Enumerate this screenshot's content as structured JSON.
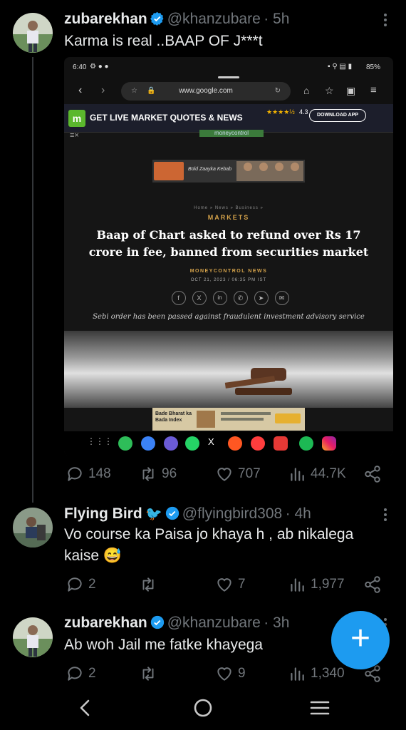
{
  "tweets": [
    {
      "name": "zubarekhan",
      "handle": "@khanzubare",
      "time": "· 5h",
      "text": "Karma is real ..BAAP OF J***t",
      "replies": "148",
      "retweets": "96",
      "likes": "707",
      "views": "44.7K"
    },
    {
      "name": "Flying Bird",
      "handle": "@flyingbird308",
      "time": "· 4h",
      "text": "Vo course ka Paisa jo khaya h , ab nikalega kaise 😅",
      "replies": "2",
      "retweets": "",
      "likes": "7",
      "views": "1,977"
    },
    {
      "name": "zubarekhan",
      "handle": "@khanzubare",
      "time": "· 3h",
      "text": "Ab woh Jail me fatke khayega",
      "replies": "2",
      "retweets": "",
      "likes": "9",
      "views": "1,340"
    }
  ],
  "embedded_screenshot": {
    "status_time": "6:40",
    "battery": "85%",
    "url": "www.google.com",
    "banner_title": "GET LIVE MARKET QUOTES & NEWS",
    "banner_rating": "4.3",
    "banner_button": "DOWNLOAD APP",
    "site_name": "moneycontrol",
    "ad_text": "Bold Zaayka Kebab",
    "breadcrumb": "Home » News » Business »",
    "section": "MARKETS",
    "headline": "Baap of Chart asked to refund over Rs 17 crore in fee, banned from securities market",
    "byline": "MONEYCONTROL NEWS",
    "dateline": "OCT 21, 2023 / 06:35 PM IST",
    "summary": "Sebi order has been passed against fraudulent investment advisory service",
    "bottom_ad": "Bade Bharat ka Bada Index"
  },
  "fab_label": "+",
  "colors": {
    "accent": "#1d9bf0",
    "text": "#e7e9ea",
    "muted": "#71767b",
    "bg": "#000000"
  }
}
